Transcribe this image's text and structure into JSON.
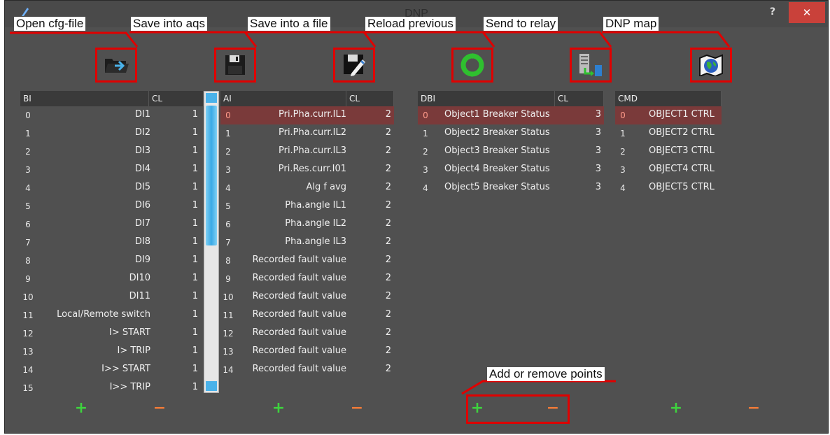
{
  "window": {
    "title": "DNP",
    "help_label": "?",
    "close_label": "✕"
  },
  "annotations": {
    "open_cfg": "Open cfg-file",
    "save_aqs": "Save into aqs",
    "save_file": "Save into a file",
    "reload": "Reload previous",
    "send_relay": "Send to relay",
    "dnp_map": "DNP map",
    "add_remove": "Add or remove points"
  },
  "icons": {
    "open": "folder-open-icon",
    "save_aqs": "floppy-disk-icon",
    "save_file": "floppy-pencil-icon",
    "reload": "refresh-icon",
    "send": "send-to-relay-icon",
    "map": "globe-map-icon"
  },
  "colors": {
    "accent_red": "#e00000",
    "selected_row": "#7a3a3a",
    "add": "#3ed23e",
    "remove": "#f07a38",
    "close": "#c9413a"
  },
  "bi": {
    "header": "BI",
    "cl_header": "CL",
    "rows": [
      {
        "idx": "0",
        "name": "DI1",
        "cl": "1"
      },
      {
        "idx": "1",
        "name": "DI2",
        "cl": "1"
      },
      {
        "idx": "2",
        "name": "DI3",
        "cl": "1"
      },
      {
        "idx": "3",
        "name": "DI4",
        "cl": "1"
      },
      {
        "idx": "4",
        "name": "DI5",
        "cl": "1"
      },
      {
        "idx": "5",
        "name": "DI6",
        "cl": "1"
      },
      {
        "idx": "6",
        "name": "DI7",
        "cl": "1"
      },
      {
        "idx": "7",
        "name": "DI8",
        "cl": "1"
      },
      {
        "idx": "8",
        "name": "DI9",
        "cl": "1"
      },
      {
        "idx": "9",
        "name": "DI10",
        "cl": "1"
      },
      {
        "idx": "10",
        "name": "DI11",
        "cl": "1"
      },
      {
        "idx": "11",
        "name": "Local/Remote switch",
        "cl": "1"
      },
      {
        "idx": "12",
        "name": "I> START",
        "cl": "1"
      },
      {
        "idx": "13",
        "name": "I> TRIP",
        "cl": "1"
      },
      {
        "idx": "14",
        "name": "I>> START",
        "cl": "1"
      },
      {
        "idx": "15",
        "name": "I>> TRIP",
        "cl": "1"
      }
    ]
  },
  "ai": {
    "header": "AI",
    "cl_header": "CL",
    "rows": [
      {
        "idx": "0",
        "name": "Pri.Pha.curr.IL1",
        "cl": "2"
      },
      {
        "idx": "1",
        "name": "Pri.Pha.curr.IL2",
        "cl": "2"
      },
      {
        "idx": "2",
        "name": "Pri.Pha.curr.IL3",
        "cl": "2"
      },
      {
        "idx": "3",
        "name": "Pri.Res.curr.I01",
        "cl": "2"
      },
      {
        "idx": "4",
        "name": "Alg f avg",
        "cl": "2"
      },
      {
        "idx": "5",
        "name": "Pha.angle IL1",
        "cl": "2"
      },
      {
        "idx": "6",
        "name": "Pha.angle IL2",
        "cl": "2"
      },
      {
        "idx": "7",
        "name": "Pha.angle IL3",
        "cl": "2"
      },
      {
        "idx": "8",
        "name": "Recorded fault value",
        "cl": "2"
      },
      {
        "idx": "9",
        "name": "Recorded fault value",
        "cl": "2"
      },
      {
        "idx": "10",
        "name": "Recorded fault value",
        "cl": "2"
      },
      {
        "idx": "11",
        "name": "Recorded fault value",
        "cl": "2"
      },
      {
        "idx": "12",
        "name": "Recorded fault value",
        "cl": "2"
      },
      {
        "idx": "13",
        "name": "Recorded fault value",
        "cl": "2"
      },
      {
        "idx": "14",
        "name": "Recorded fault value",
        "cl": "2"
      }
    ]
  },
  "dbi": {
    "header": "DBI",
    "cl_header": "CL",
    "rows": [
      {
        "idx": "0",
        "name": "Object1 Breaker Status",
        "cl": "3"
      },
      {
        "idx": "1",
        "name": "Object2 Breaker Status",
        "cl": "3"
      },
      {
        "idx": "2",
        "name": "Object3 Breaker Status",
        "cl": "3"
      },
      {
        "idx": "3",
        "name": "Object4 Breaker Status",
        "cl": "3"
      },
      {
        "idx": "4",
        "name": "Object5 Breaker Status",
        "cl": "3"
      }
    ]
  },
  "cmd": {
    "header": "CMD",
    "rows": [
      {
        "idx": "0",
        "name": "OBJECT1 CTRL"
      },
      {
        "idx": "1",
        "name": "OBJECT2 CTRL"
      },
      {
        "idx": "2",
        "name": "OBJECT3 CTRL"
      },
      {
        "idx": "3",
        "name": "OBJECT4 CTRL"
      },
      {
        "idx": "4",
        "name": "OBJECT5 CTRL"
      }
    ]
  },
  "buttons": {
    "add": "+",
    "remove": "−"
  }
}
